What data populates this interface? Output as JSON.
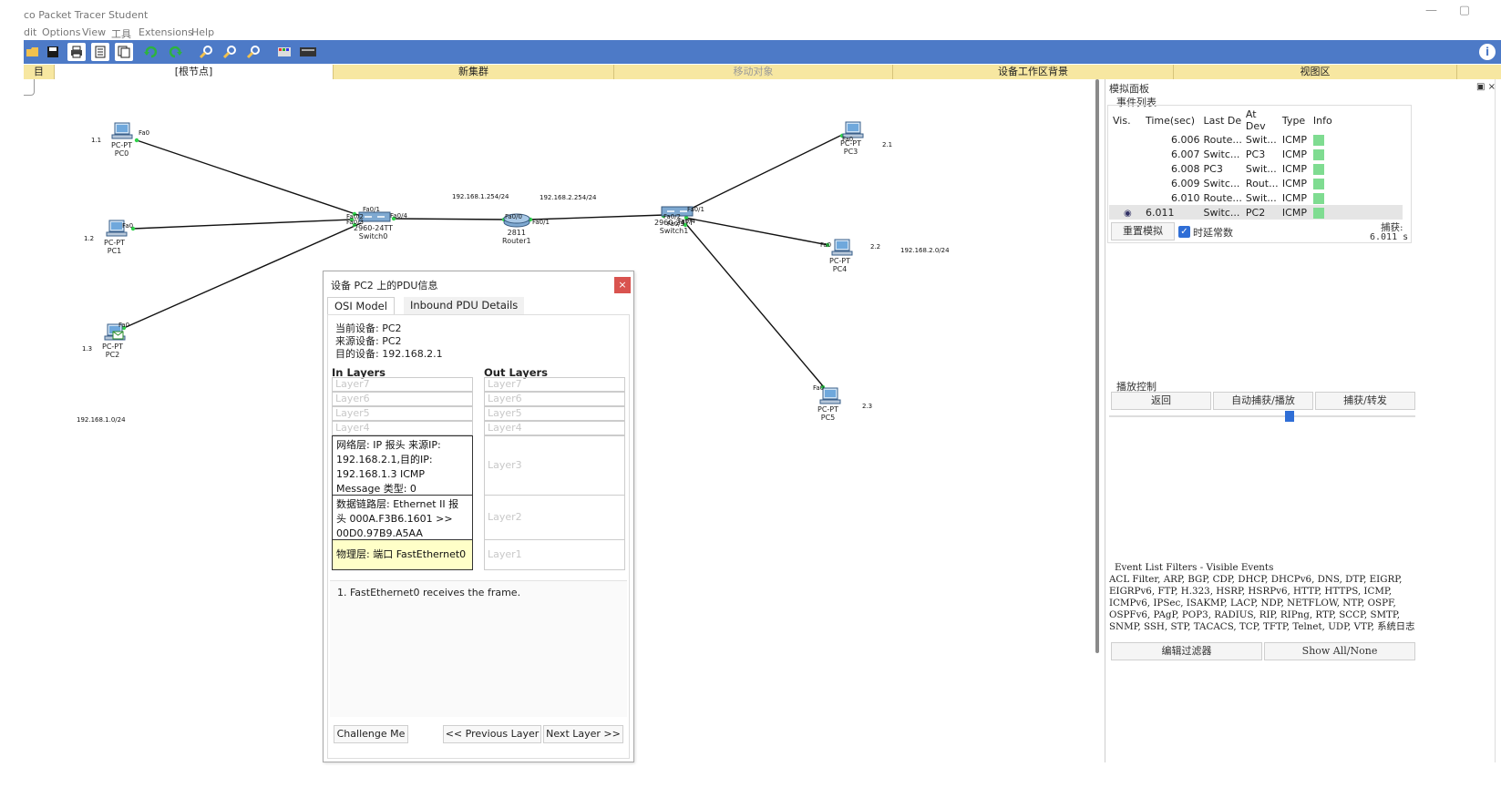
{
  "window": {
    "title": "co Packet Tracer Student",
    "minimize_glyph": "—",
    "restore_glyph": "▢"
  },
  "menu": [
    "dit",
    "Options",
    "View",
    "工具",
    "Extensions",
    "Help"
  ],
  "toolbar_icons": [
    "open-icon",
    "save-icon",
    "print-icon",
    "activity-wizard-icon",
    "copy-icon",
    "undo-icon",
    "redo-icon",
    "zoom-in-icon",
    "zoom-reset-icon",
    "zoom-out-icon",
    "palette-icon",
    "custom-device-icon",
    "info-icon"
  ],
  "toolbar_glyphs": {
    "info": "i"
  },
  "navbar": {
    "left_glyph": "目",
    "root": "[根节点]",
    "new_cluster": "新集群",
    "move_object": "移动对象",
    "workspace_bg": "设备工作区背景",
    "viewport": "视图区"
  },
  "canvas": {
    "devices": [
      {
        "id": "PC0",
        "type": "PC-PT",
        "name": "PC0",
        "addr": "1.1",
        "port": "Fa0"
      },
      {
        "id": "PC1",
        "type": "PC-PT",
        "name": "PC1",
        "addr": "1.2",
        "port": "Fa0"
      },
      {
        "id": "PC2",
        "type": "PC-PT",
        "name": "PC2",
        "addr": "1.3",
        "port": "Fa0"
      },
      {
        "id": "PC3",
        "type": "PC-PT",
        "name": "PC3",
        "addr": "2.1",
        "port": "Fa0"
      },
      {
        "id": "PC4",
        "type": "PC-PT",
        "name": "PC4",
        "addr": "2.2",
        "port": "Fa0"
      },
      {
        "id": "PC5",
        "type": "PC-PT",
        "name": "PC5",
        "addr": "2.3",
        "port": "Fa0"
      },
      {
        "id": "Switch0",
        "type": "2960-24TT",
        "name": "Switch0"
      },
      {
        "id": "Router1",
        "type": "2811",
        "name": "Router1"
      },
      {
        "id": "Switch1",
        "type": "2960-24TT",
        "name": "Switch1"
      }
    ],
    "port_labels": {
      "sw0_fa01": "Fa0/1",
      "sw0_fa02": "Fa0/2",
      "sw0_fa03": "Fa0/3",
      "sw0_fa04": "Fa0/4",
      "r1_fa00": "Fa0/0",
      "r1_fa01": "Fa0/1",
      "sw1_fa01": "Fa0/1",
      "sw1_fa02": "Fa0/2",
      "sw1_fa03": "Fa0/3",
      "sw1_fa04": "Fa0/4"
    },
    "network_labels": {
      "gw1": "192.168.1.254/24",
      "gw2": "192.168.2.254/24",
      "net1": "192.168.1.0/24",
      "net2": "192.168.2.0/24"
    }
  },
  "sim_panel": {
    "title": "模拟面板",
    "controls": "▣ ×",
    "event_list_label": "事件列表",
    "columns": [
      "Vis.",
      "Time(sec)",
      "Last De",
      "At Dev",
      "Type",
      "Info"
    ],
    "events": [
      {
        "vis": "",
        "time": "6.006",
        "last": "Route...",
        "at": "Swit...",
        "type": "ICMP",
        "info_color": "#7fdc91"
      },
      {
        "vis": "",
        "time": "6.007",
        "last": "Switc...",
        "at": "PC3",
        "type": "ICMP",
        "info_color": "#7fdc91"
      },
      {
        "vis": "",
        "time": "6.008",
        "last": "PC3",
        "at": "Swit...",
        "type": "ICMP",
        "info_color": "#7fdc91"
      },
      {
        "vis": "",
        "time": "6.009",
        "last": "Switc...",
        "at": "Rout...",
        "type": "ICMP",
        "info_color": "#7fdc91"
      },
      {
        "vis": "",
        "time": "6.010",
        "last": "Route...",
        "at": "Swit...",
        "type": "ICMP",
        "info_color": "#7fdc91"
      },
      {
        "vis": "eye",
        "time": "6.011",
        "last": "Switc...",
        "at": "PC2",
        "type": "ICMP",
        "info_color": "#7fdc91"
      }
    ],
    "reset_button": "重置模拟",
    "constant_delay_label": "时延常数",
    "capture_label": "捕获:",
    "capture_value": "6.011 s",
    "playback_label": "播放控制",
    "back_button": "返回",
    "auto_button": "自动捕获/播放",
    "forward_button": "捕获/转发",
    "slider_value": 0.59,
    "filters_title": "Event List Filters - Visible Events",
    "filters_text": "ACL Filter, ARP, BGP, CDP, DHCP, DHCPv6, DNS, DTP, EIGRP, EIGRPv6, FTP, H.323, HSRP, HSRPv6, HTTP, HTTPS, ICMP, ICMPv6, IPSec, ISAKMP, LACP, NDP, NETFLOW, NTP, OSPF, OSPFv6, PAgP, POP3, RADIUS, RIP, RIPng, RTP, SCCP, SMTP, SNMP, SSH, STP, TACACS, TCP, TFTP, Telnet, UDP, VTP, 系统日志",
    "edit_filters": "编辑过滤器",
    "show_all": "Show All/None"
  },
  "pdu": {
    "title": "设备 PC2 上的PDU信息",
    "close": "×",
    "tab_osi": "OSI Model",
    "tab_inbound": "Inbound PDU Details",
    "current_device": "当前设备: PC2",
    "source_device": "来源设备: PC2",
    "dest_device": "目的设备: 192.168.2.1",
    "in_layers": "In Layers",
    "out_layers": "Out Layers",
    "in": {
      "l7": "Layer7",
      "l6": "Layer6",
      "l5": "Layer5",
      "l4": "Layer4",
      "l3": "网络层: IP 报头 来源IP: 192.168.2.1,目的IP: 192.168.1.3 ICMP Message 类型: 0",
      "l2": "数据链路层: Ethernet II 报头 000A.F3B6.1601 >> 00D0.97B9.A5AA",
      "l1": "物理层: 端口 FastEthernet0"
    },
    "out": {
      "l7": "Layer7",
      "l6": "Layer6",
      "l5": "Layer5",
      "l4": "Layer4",
      "l3": "Layer3",
      "l2": "Layer2",
      "l1": "Layer1"
    },
    "description": "1. FastEthernet0 receives the frame.",
    "challenge": "Challenge Me",
    "prev": "<< Previous Layer",
    "next": "Next Layer >>"
  }
}
